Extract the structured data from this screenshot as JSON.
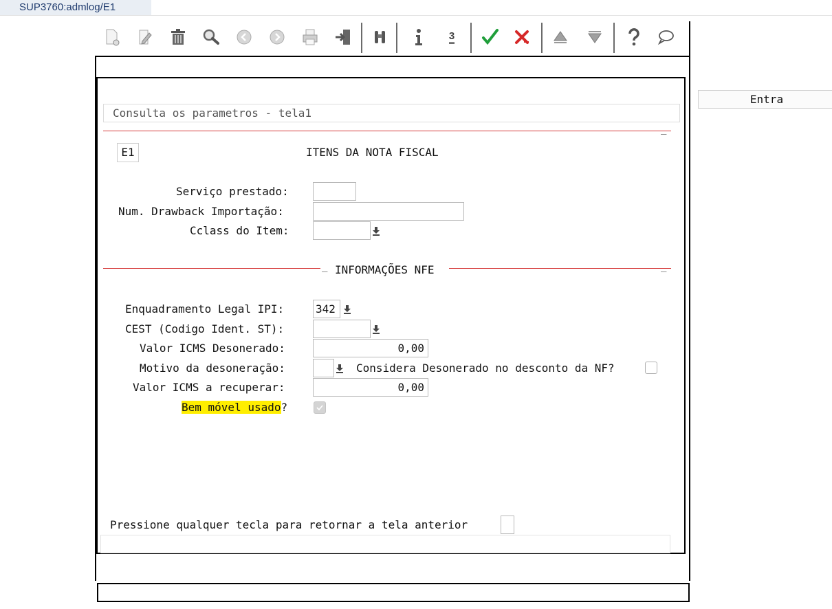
{
  "window": {
    "title": "SUP3760:admlog/E1"
  },
  "toolbar": {
    "buttons": [
      {
        "icon": "new-record-icon"
      },
      {
        "icon": "edit-icon"
      },
      {
        "icon": "trash-icon"
      },
      {
        "icon": "search-icon"
      },
      {
        "icon": "previous-icon"
      },
      {
        "icon": "next-icon"
      },
      {
        "icon": "print-icon"
      },
      {
        "icon": "exit-icon"
      },
      {
        "icon": "binoculars-icon"
      },
      {
        "icon": "info-icon"
      },
      {
        "icon": "zoom-3-icon"
      },
      {
        "icon": "confirm-icon"
      },
      {
        "icon": "cancel-icon"
      },
      {
        "icon": "first-icon"
      },
      {
        "icon": "last-icon"
      },
      {
        "icon": "help-icon"
      },
      {
        "icon": "chat-icon"
      }
    ],
    "zoom_label": "3"
  },
  "entra_button": "Entra",
  "panel": {
    "header": "Consulta os parametros - tela1",
    "frame_code": "E1",
    "frame_title": "ITENS DA NOTA FISCAL",
    "section_title": "INFORMAÇÕES NFE",
    "dash": "_",
    "fields": {
      "servico_prestado": {
        "label": "Serviço prestado:",
        "value": ""
      },
      "num_drawback": {
        "label": "Num. Drawback Importação:",
        "value": ""
      },
      "cclass_item": {
        "label": "Cclass do Item:",
        "value": ""
      },
      "enquadramento_ipi": {
        "label": "Enquadramento Legal IPI:",
        "value": "342"
      },
      "cest": {
        "label": "CEST (Codigo Ident. ST):",
        "value": ""
      },
      "valor_icms_desonerado": {
        "label": "Valor ICMS Desonerado:",
        "value": "0,00"
      },
      "motivo_desoneracao": {
        "label": "Motivo da desoneração:",
        "value": ""
      },
      "considera_desonerado": {
        "label": "Considera Desonerado no desconto da NF?",
        "checked": false
      },
      "valor_icms_recuperar": {
        "label": "Valor ICMS a recuperar:",
        "value": "0,00"
      },
      "bem_movel_usado": {
        "label": "Bem móvel usado",
        "suffix": "?",
        "checked": true,
        "highlight_color": "#ffee00"
      }
    },
    "prompt": "Pressione qualquer tecla para retornar a tela anterior"
  },
  "colors": {
    "accent_line": "#d63a3a",
    "confirm": "#1f9e3a",
    "cancel": "#d62828"
  }
}
